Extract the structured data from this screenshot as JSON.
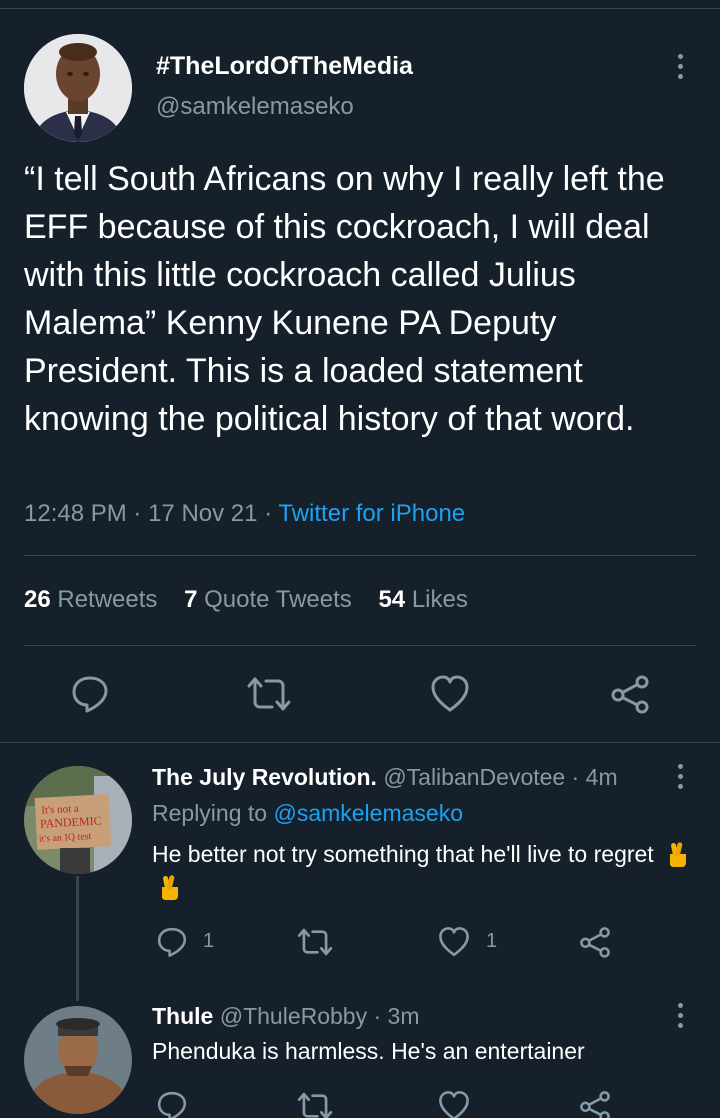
{
  "tweet": {
    "display_name": "#TheLordOfTheMedia",
    "handle": "@samkelemaseko",
    "text": "“I tell South Africans on why I really left the EFF because of this cockroach, I will deal with this little cockroach called Julius Malema” Kenny Kunene PA Deputy President. This is a loaded statement knowing the political history of that word.",
    "time": "12:48 PM",
    "date": "17 Nov 21",
    "separator": "·",
    "source": "Twitter for iPhone",
    "stats": {
      "retweets_count": "26",
      "retweets_label": "Retweets",
      "quotes_count": "7",
      "quotes_label": "Quote Tweets",
      "likes_count": "54",
      "likes_label": "Likes"
    }
  },
  "replies": [
    {
      "display_name": "The July Revolution.",
      "handle": "@TalibanDevotee",
      "time": "· 4m",
      "replying_to_label": "Replying to",
      "replying_to_handle": "@samkelemaseko",
      "text": "He better not try something that he'll live to regret",
      "emoji": [
        "crossed-fingers-emoji",
        "crossed-fingers-emoji"
      ],
      "reply_count": "1",
      "like_count": "1",
      "sign_text": [
        "It's not a",
        "PANDEMIC",
        "it's an IQ test"
      ]
    },
    {
      "display_name": "Thule",
      "handle": "@ThuleRobby",
      "time": "· 3m",
      "text": "Phenduka is harmless. He's an entertainer"
    }
  ],
  "icons": [
    "reply-icon",
    "retweet-icon",
    "like-icon",
    "share-icon",
    "more-icon"
  ],
  "colors": {
    "background": "#15202b",
    "divider": "#38444d",
    "secondary_text": "#8899a6",
    "accent": "#1da1f2"
  }
}
